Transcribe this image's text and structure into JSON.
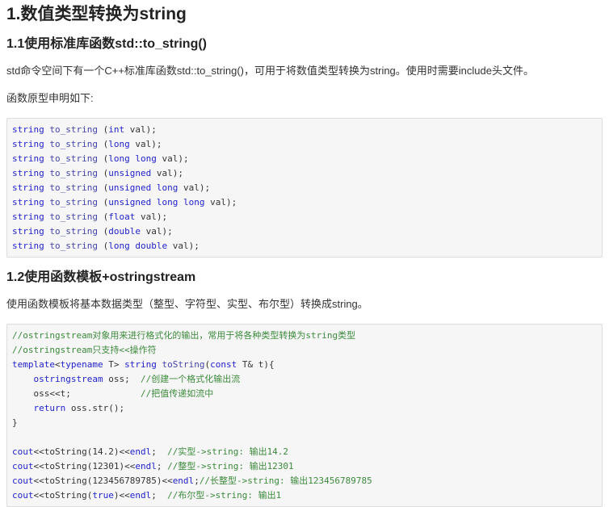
{
  "h1": "1.数值类型转换为string",
  "section1": {
    "heading": "1.1使用标准库函数std::to_string()",
    "para1": "std命令空间下有一个C++标准库函数std::to_string()，可用于将数值类型转换为string。使用时需要include头文件。",
    "para2": "函数原型申明如下:",
    "code": [
      [
        [
          "kw",
          "string"
        ],
        [
          "plain",
          " "
        ],
        [
          "fn",
          "to_string"
        ],
        [
          "plain",
          " ("
        ],
        [
          "kw",
          "int"
        ],
        [
          "plain",
          " val);"
        ]
      ],
      [
        [
          "kw",
          "string"
        ],
        [
          "plain",
          " "
        ],
        [
          "fn",
          "to_string"
        ],
        [
          "plain",
          " ("
        ],
        [
          "kw",
          "long"
        ],
        [
          "plain",
          " val);"
        ]
      ],
      [
        [
          "kw",
          "string"
        ],
        [
          "plain",
          " "
        ],
        [
          "fn",
          "to_string"
        ],
        [
          "plain",
          " ("
        ],
        [
          "kw",
          "long long"
        ],
        [
          "plain",
          " val);"
        ]
      ],
      [
        [
          "kw",
          "string"
        ],
        [
          "plain",
          " "
        ],
        [
          "fn",
          "to_string"
        ],
        [
          "plain",
          " ("
        ],
        [
          "kw",
          "unsigned"
        ],
        [
          "plain",
          " val);"
        ]
      ],
      [
        [
          "kw",
          "string"
        ],
        [
          "plain",
          " "
        ],
        [
          "fn",
          "to_string"
        ],
        [
          "plain",
          " ("
        ],
        [
          "kw",
          "unsigned long"
        ],
        [
          "plain",
          " val);"
        ]
      ],
      [
        [
          "kw",
          "string"
        ],
        [
          "plain",
          " "
        ],
        [
          "fn",
          "to_string"
        ],
        [
          "plain",
          " ("
        ],
        [
          "kw",
          "unsigned long long"
        ],
        [
          "plain",
          " val);"
        ]
      ],
      [
        [
          "kw",
          "string"
        ],
        [
          "plain",
          " "
        ],
        [
          "fn",
          "to_string"
        ],
        [
          "plain",
          " ("
        ],
        [
          "kw",
          "float"
        ],
        [
          "plain",
          " val);"
        ]
      ],
      [
        [
          "kw",
          "string"
        ],
        [
          "plain",
          " "
        ],
        [
          "fn",
          "to_string"
        ],
        [
          "plain",
          " ("
        ],
        [
          "kw",
          "double"
        ],
        [
          "plain",
          " val);"
        ]
      ],
      [
        [
          "kw",
          "string"
        ],
        [
          "plain",
          " "
        ],
        [
          "fn",
          "to_string"
        ],
        [
          "plain",
          " ("
        ],
        [
          "kw",
          "long double"
        ],
        [
          "plain",
          " val);"
        ]
      ]
    ]
  },
  "section2": {
    "heading": "1.2使用函数模板+ostringstream",
    "para1": "使用函数模板将基本数据类型（整型、字符型、实型、布尔型）转换成string。",
    "code": [
      [
        [
          "cm",
          "//ostringstream对象用来进行格式化的输出，常用于将各种类型转换为string类型"
        ]
      ],
      [
        [
          "cm",
          "//ostringstream只支持<<操作符"
        ]
      ],
      [
        [
          "kw",
          "template"
        ],
        [
          "plain",
          "<"
        ],
        [
          "kw",
          "typename"
        ],
        [
          "plain",
          " T> "
        ],
        [
          "kw",
          "string"
        ],
        [
          "plain",
          " "
        ],
        [
          "fn",
          "toString"
        ],
        [
          "plain",
          "("
        ],
        [
          "kw",
          "const"
        ],
        [
          "plain",
          " T& t){"
        ]
      ],
      [
        [
          "plain",
          "    "
        ],
        [
          "kw",
          "ostringstream"
        ],
        [
          "plain",
          " oss;  "
        ],
        [
          "cm",
          "//创建一个格式化输出流"
        ]
      ],
      [
        [
          "plain",
          "    oss<<t;             "
        ],
        [
          "cm",
          "//把值传递如流中"
        ]
      ],
      [
        [
          "plain",
          "    "
        ],
        [
          "kw",
          "return"
        ],
        [
          "plain",
          " oss.str();"
        ]
      ],
      [
        [
          "plain",
          "}"
        ]
      ],
      [
        [
          "plain",
          ""
        ]
      ],
      [
        [
          "kw",
          "cout"
        ],
        [
          "plain",
          "<<toString(14.2)<<"
        ],
        [
          "kw",
          "endl"
        ],
        [
          "plain",
          ";  "
        ],
        [
          "cm",
          "//实型->string: 输出14.2"
        ]
      ],
      [
        [
          "kw",
          "cout"
        ],
        [
          "plain",
          "<<toString(12301)<<"
        ],
        [
          "kw",
          "endl"
        ],
        [
          "plain",
          "; "
        ],
        [
          "cm",
          "//整型->string: 输出12301"
        ]
      ],
      [
        [
          "kw",
          "cout"
        ],
        [
          "plain",
          "<<toString(123456789785)<<"
        ],
        [
          "kw",
          "endl"
        ],
        [
          "plain",
          ";"
        ],
        [
          "cm",
          "//长整型->string: 输出123456789785"
        ]
      ],
      [
        [
          "kw",
          "cout"
        ],
        [
          "plain",
          "<<toString("
        ],
        [
          "kw",
          "true"
        ],
        [
          "plain",
          ")<<"
        ],
        [
          "kw",
          "endl"
        ],
        [
          "plain",
          ";  "
        ],
        [
          "cm",
          "//布尔型->string: 输出1"
        ]
      ]
    ]
  }
}
